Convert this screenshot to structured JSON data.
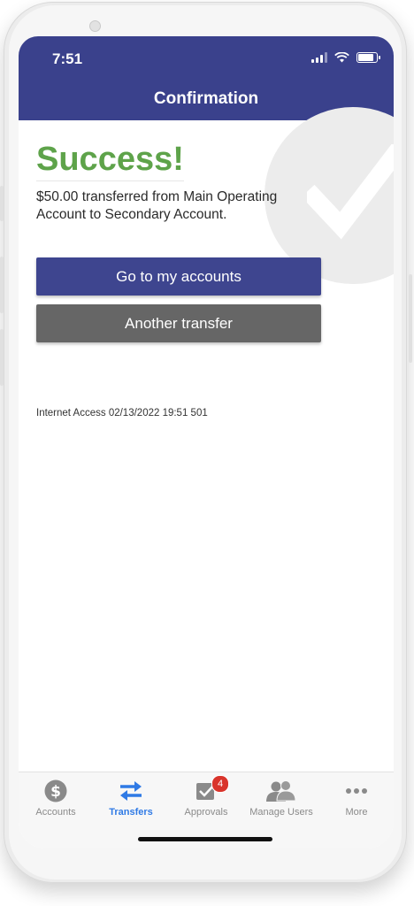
{
  "status_bar": {
    "time": "7:51"
  },
  "header": {
    "title": "Confirmation"
  },
  "content": {
    "heading": "Success!",
    "message": "$50.00 transferred from Main Operating Account to Secondary Account.",
    "primary_button": "Go to my accounts",
    "secondary_button": "Another transfer",
    "access_info": "Internet Access 02/13/2022 19:51 501"
  },
  "tabbar": {
    "items": [
      {
        "label": "Accounts",
        "icon": "dollar-icon",
        "active": false
      },
      {
        "label": "Transfers",
        "icon": "transfer-arrows-icon",
        "active": true
      },
      {
        "label": "Approvals",
        "icon": "checkbox-icon",
        "active": false,
        "badge": "4"
      },
      {
        "label": "Manage Users",
        "icon": "users-icon",
        "active": false
      },
      {
        "label": "More",
        "icon": "more-dots-icon",
        "active": false
      }
    ]
  },
  "colors": {
    "header": "#3a418c",
    "success": "#5ea34a",
    "primary_button": "#3e458f",
    "secondary_button": "#666666",
    "active_tab": "#2f7ae5",
    "badge": "#d9342b"
  }
}
